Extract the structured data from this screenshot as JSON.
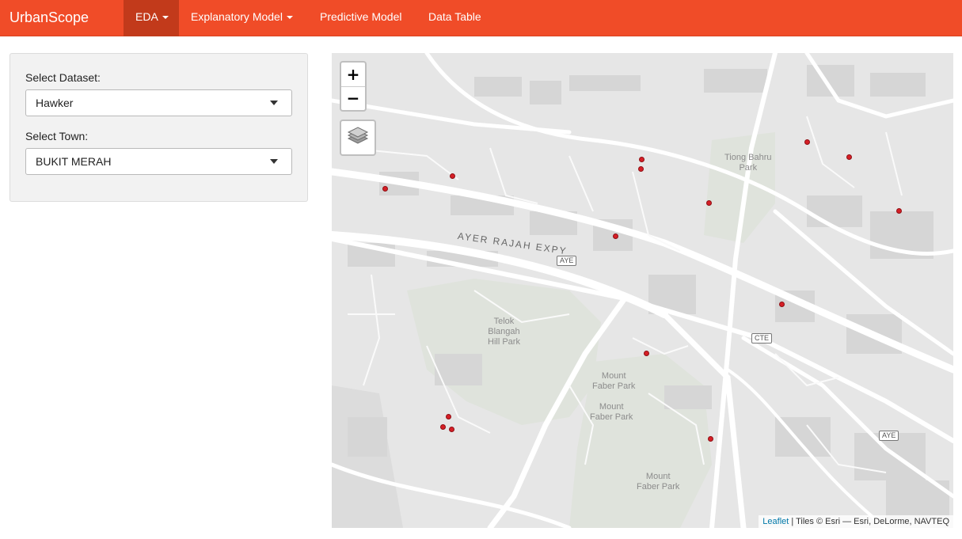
{
  "navbar": {
    "brand": "UrbanScope",
    "items": [
      {
        "label": "EDA",
        "dropdown": true,
        "active": true
      },
      {
        "label": "Explanatory Model",
        "dropdown": true,
        "active": false
      },
      {
        "label": "Predictive Model",
        "dropdown": false,
        "active": false
      },
      {
        "label": "Data Table",
        "dropdown": false,
        "active": false
      }
    ]
  },
  "sidebar": {
    "dataset_label": "Select Dataset:",
    "dataset_value": "Hawker",
    "town_label": "Select Town:",
    "town_value": "BUKIT MERAH"
  },
  "map": {
    "zoom_in": "+",
    "zoom_out": "−",
    "layers_icon": "layers-icon",
    "labels": {
      "tiong_bahru": "Tiong Bahru\nPark",
      "telok_blangah": "Telok\nBlangah\nHill Park",
      "mount_faber_1": "Mount\nFaber Park",
      "mount_faber_2": "Mount\nFaber Park",
      "mount_faber_3": "Mount\nFaber Park",
      "expressway": "AYER RAJAH EXPY",
      "aye_1": "AYE",
      "aye_2": "AYE",
      "cte": "CTE"
    },
    "attribution_link": "Leaflet",
    "attribution_text": " | Tiles © Esri — Esri, DeLorme, NAVTEQ",
    "marker_color": "#d61f26"
  },
  "colors": {
    "navbar": "#f04c28",
    "navbar_active": "#c23a1b"
  }
}
